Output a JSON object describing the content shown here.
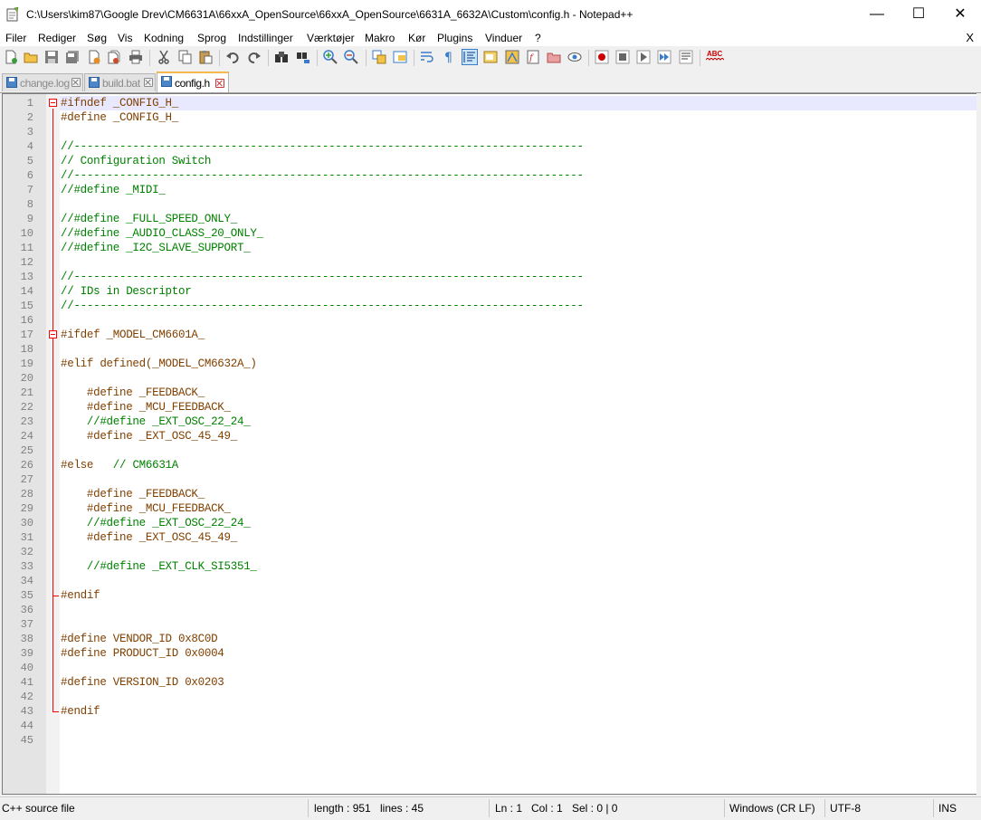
{
  "window": {
    "title": "C:\\Users\\kim87\\Google Drev\\CM6631A\\66xxA_OpenSource\\66xxA_OpenSource\\6631A_6632A\\Custom\\config.h - Notepad++",
    "minimize": "—",
    "maximize": "☐",
    "close": "✕"
  },
  "menu": {
    "items": [
      "Filer",
      "Rediger",
      "Søg",
      "Vis",
      "Kodning",
      "Sprog",
      "Indstillinger",
      "Værktøjer",
      "Makro",
      "Kør",
      "Plugins",
      "Vinduer",
      "?"
    ],
    "close": "X"
  },
  "toolbar": {
    "icons": [
      "new-file-icon",
      "open-file-icon",
      "save-icon",
      "save-all-icon",
      "close-icon",
      "close-all-icon",
      "print-icon",
      "cut-icon",
      "copy-icon",
      "paste-icon",
      "undo-icon",
      "redo-icon",
      "find-icon",
      "replace-icon",
      "zoom-in-icon",
      "zoom-out-icon",
      "sync-vertical-icon",
      "sync-horizontal-icon",
      "word-wrap-icon",
      "show-all-chars-icon",
      "indent-guide-icon",
      "language-icon",
      "document-map-icon",
      "function-list-icon",
      "folder-workspace-icon",
      "monitoring-icon",
      "record-macro-icon",
      "stop-record-icon",
      "play-macro-icon",
      "run-macro-multiple-icon",
      "save-macro-icon",
      "spell-check-icon"
    ],
    "spellcheck_label": "ABC"
  },
  "tabs": [
    {
      "label": "change.log",
      "active": false
    },
    {
      "label": "build.bat",
      "active": false
    },
    {
      "label": "config.h",
      "active": true
    }
  ],
  "editor": {
    "lines": [
      {
        "n": "1",
        "parts": [
          {
            "t": "#ifndef _CONFIG_H_",
            "c": "pp"
          }
        ]
      },
      {
        "n": "2",
        "parts": [
          {
            "t": "#define _CONFIG_H_",
            "c": "pp"
          }
        ]
      },
      {
        "n": "3",
        "parts": []
      },
      {
        "n": "4",
        "parts": [
          {
            "t": "//------------------------------------------------------------------------------",
            "c": "cm"
          }
        ]
      },
      {
        "n": "5",
        "parts": [
          {
            "t": "// Configuration Switch",
            "c": "cm"
          }
        ]
      },
      {
        "n": "6",
        "parts": [
          {
            "t": "//------------------------------------------------------------------------------",
            "c": "cm"
          }
        ]
      },
      {
        "n": "7",
        "parts": [
          {
            "t": "//#define _MIDI_",
            "c": "cm"
          }
        ]
      },
      {
        "n": "8",
        "parts": []
      },
      {
        "n": "9",
        "parts": [
          {
            "t": "//#define _FULL_SPEED_ONLY_",
            "c": "cm"
          }
        ]
      },
      {
        "n": "10",
        "parts": [
          {
            "t": "//#define _AUDIO_CLASS_20_ONLY_",
            "c": "cm"
          }
        ]
      },
      {
        "n": "11",
        "parts": [
          {
            "t": "//#define _I2C_SLAVE_SUPPORT_",
            "c": "cm"
          }
        ]
      },
      {
        "n": "12",
        "parts": []
      },
      {
        "n": "13",
        "parts": [
          {
            "t": "//------------------------------------------------------------------------------",
            "c": "cm"
          }
        ]
      },
      {
        "n": "14",
        "parts": [
          {
            "t": "// IDs in Descriptor",
            "c": "cm"
          }
        ]
      },
      {
        "n": "15",
        "parts": [
          {
            "t": "//------------------------------------------------------------------------------",
            "c": "cm"
          }
        ]
      },
      {
        "n": "16",
        "parts": []
      },
      {
        "n": "17",
        "parts": [
          {
            "t": "#ifdef _MODEL_CM6601A_",
            "c": "pp"
          }
        ]
      },
      {
        "n": "18",
        "parts": []
      },
      {
        "n": "19",
        "parts": [
          {
            "t": "#elif defined(_MODEL_CM6632A_)",
            "c": "pp"
          }
        ]
      },
      {
        "n": "20",
        "parts": []
      },
      {
        "n": "21",
        "parts": [
          {
            "t": "    #define _FEEDBACK_",
            "c": "pp"
          }
        ]
      },
      {
        "n": "22",
        "parts": [
          {
            "t": "    #define _MCU_FEEDBACK_",
            "c": "pp"
          }
        ]
      },
      {
        "n": "23",
        "parts": [
          {
            "t": "    //#define _EXT_OSC_22_24_",
            "c": "cm"
          }
        ]
      },
      {
        "n": "24",
        "parts": [
          {
            "t": "    #define _EXT_OSC_45_49_",
            "c": "pp"
          }
        ]
      },
      {
        "n": "25",
        "parts": []
      },
      {
        "n": "26",
        "parts": [
          {
            "t": "#else   ",
            "c": "pp"
          },
          {
            "t": "// CM6631A",
            "c": "cm"
          }
        ]
      },
      {
        "n": "27",
        "parts": []
      },
      {
        "n": "28",
        "parts": [
          {
            "t": "    #define _FEEDBACK_",
            "c": "pp"
          }
        ]
      },
      {
        "n": "29",
        "parts": [
          {
            "t": "    #define _MCU_FEEDBACK_",
            "c": "pp"
          }
        ]
      },
      {
        "n": "30",
        "parts": [
          {
            "t": "    //#define _EXT_OSC_22_24_",
            "c": "cm"
          }
        ]
      },
      {
        "n": "31",
        "parts": [
          {
            "t": "    #define _EXT_OSC_45_49_",
            "c": "pp"
          }
        ]
      },
      {
        "n": "32",
        "parts": []
      },
      {
        "n": "33",
        "parts": [
          {
            "t": "    //#define _EXT_CLK_SI5351_",
            "c": "cm"
          }
        ]
      },
      {
        "n": "34",
        "parts": []
      },
      {
        "n": "35",
        "parts": [
          {
            "t": "#endif",
            "c": "pp"
          }
        ]
      },
      {
        "n": "36",
        "parts": []
      },
      {
        "n": "37",
        "parts": []
      },
      {
        "n": "38",
        "parts": [
          {
            "t": "#define VENDOR_ID 0x8C0D",
            "c": "pp"
          }
        ]
      },
      {
        "n": "39",
        "parts": [
          {
            "t": "#define PRODUCT_ID 0x0004",
            "c": "pp"
          }
        ]
      },
      {
        "n": "40",
        "parts": []
      },
      {
        "n": "41",
        "parts": [
          {
            "t": "#define VERSION_ID 0x0203",
            "c": "pp"
          }
        ]
      },
      {
        "n": "42",
        "parts": []
      },
      {
        "n": "43",
        "parts": [
          {
            "t": "#endif",
            "c": "pp"
          }
        ]
      },
      {
        "n": "44",
        "parts": []
      },
      {
        "n": "45",
        "parts": []
      }
    ]
  },
  "status": {
    "filetype": "C++ source file",
    "length": "length : 951",
    "lines": "lines : 45",
    "ln": "Ln : 1",
    "col": "Col : 1",
    "sel": "Sel : 0 | 0",
    "eol": "Windows (CR LF)",
    "encoding": "UTF-8",
    "mode": "INS"
  },
  "colors": {
    "preprocessor": "#804000",
    "comment": "#008000",
    "fold_marker": "#ff0000",
    "current_line": "#e8e8ff",
    "active_tab_accent": "#f6b94b"
  }
}
